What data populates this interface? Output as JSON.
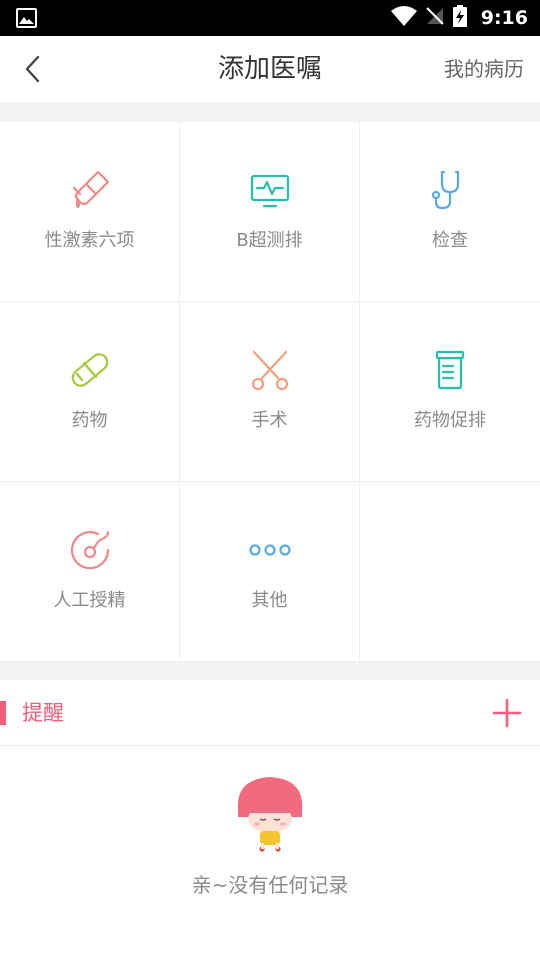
{
  "status_bar": {
    "time": "9:16"
  },
  "header": {
    "title": "添加医嘱",
    "right_link": "我的病历"
  },
  "grid": [
    {
      "label": "性激素六项",
      "icon": "test-tube-icon",
      "color": "#ef8a8a"
    },
    {
      "label": "B超测排",
      "icon": "monitor-icon",
      "color": "#27bfa6"
    },
    {
      "label": "检查",
      "icon": "stethoscope-icon",
      "color": "#5aa9e6"
    },
    {
      "label": "药物",
      "icon": "pill-icon",
      "color": "#a6c93a"
    },
    {
      "label": "手术",
      "icon": "scissors-icon",
      "color": "#f0a07a"
    },
    {
      "label": "药物促排",
      "icon": "medicine-bottle-icon",
      "color": "#27bfa6"
    },
    {
      "label": "人工授精",
      "icon": "sperm-egg-icon",
      "color": "#ef8a8a"
    },
    {
      "label": "其他",
      "icon": "more-dots-icon",
      "color": "#5aa9e6"
    }
  ],
  "reminder": {
    "label": "提醒"
  },
  "empty_state": {
    "message": "亲~没有任何记录"
  },
  "colors": {
    "accent": "#f2607a",
    "divider": "#f4f4f4"
  }
}
